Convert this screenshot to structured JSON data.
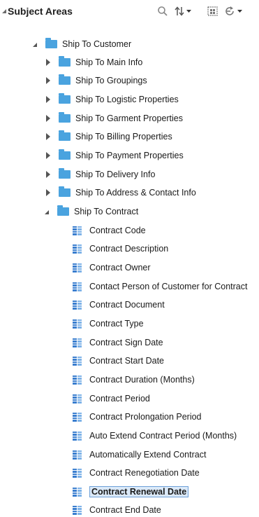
{
  "header": {
    "title": "Subject Areas"
  },
  "icons": {
    "collapse": "triangle-down-icon",
    "search": "search-icon",
    "sort": "sort-icon",
    "select_all": "select-columns-icon",
    "refresh": "refresh-icon"
  },
  "colors": {
    "folder": "#4aa3df",
    "column_icon": "#3a7ecf",
    "selection_border": "#6ea0d8",
    "selection_fill": "#dbe9f8"
  },
  "tree": {
    "root": "Ship To Customer",
    "folders": [
      "Ship To Main Info",
      "Ship To Groupings",
      "Ship To Logistic Properties",
      "Ship To Garment Properties",
      "Ship To Billing Properties",
      "Ship To Payment Properties",
      "Ship To Delivery Info",
      "Ship To Address & Contact Info"
    ],
    "open_folder": "Ship To Contract",
    "columns": [
      "Contract Code",
      "Contract Description",
      "Contract Owner",
      "Contact Person of Customer for Contract",
      "Contract Document",
      "Contract Type",
      "Contract Sign Date",
      "Contract Start Date",
      "Contract Duration (Months)",
      "Contract Period",
      "Contract Prolongation Period",
      "Auto Extend Contract Period (Months)",
      "Automatically Extend Contract",
      "Contract Renegotiation Date",
      "Contract Renewal Date",
      "Contract End Date"
    ],
    "selected_column": "Contract Renewal Date"
  }
}
